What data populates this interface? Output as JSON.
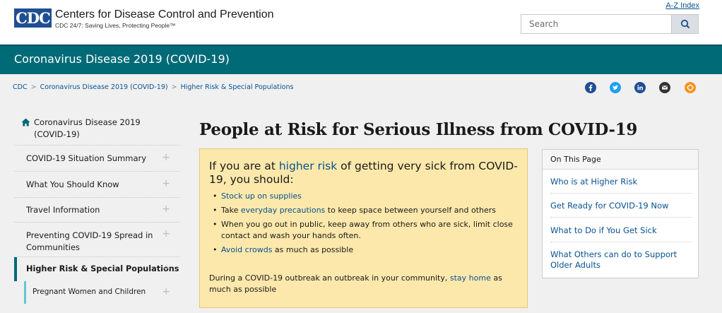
{
  "header": {
    "logo_text": "CDC",
    "org_name": "Centers for Disease Control and Prevention",
    "tagline": "CDC 24/7: Saving Lives, Protecting People™",
    "az_index": "A-Z Index",
    "search_placeholder": "Search",
    "search_icon": "magnifier-icon"
  },
  "banner": {
    "title": "Coronavirus Disease 2019 (COVID-19)"
  },
  "breadcrumb": {
    "items": [
      "CDC",
      "Coronavirus Disease 2019 (COVID-19)",
      "Higher Risk & Special Populations"
    ],
    "separator": ">"
  },
  "social": {
    "icons": [
      "facebook-icon",
      "twitter-icon",
      "linkedin-icon",
      "email-icon",
      "syndicate-icon"
    ],
    "colors": {
      "facebook": "#1f4e93",
      "twitter": "#1da1f2",
      "linkedin": "#1f4e93",
      "email": "#333333",
      "syndicate": "#f7941d"
    }
  },
  "nav": {
    "home_label": "Coronavirus Disease 2019 (COVID-19)",
    "items": [
      {
        "label": "COVID-19 Situation Summary",
        "toggle": "+"
      },
      {
        "label": "What You Should Know",
        "toggle": "+"
      },
      {
        "label": "Travel Information",
        "toggle": "+"
      },
      {
        "label": "Preventing COVID-19 Spread in Communities",
        "toggle": "+"
      },
      {
        "label": "Higher Risk & Special Populations",
        "toggle": "—"
      },
      {
        "label": "Pregnant Women and Children",
        "toggle": "+"
      }
    ]
  },
  "main": {
    "title": "People at Risk for Serious Illness from COVID-19",
    "callout": {
      "head_before": "If you are at ",
      "head_link": "higher risk",
      "head_after": " of getting very sick from COVID-19, you should:",
      "bullets": [
        {
          "link": "Stock up on supplies",
          "after": ""
        },
        {
          "before": "Take ",
          "link": "everyday precautions",
          "after": " to keep space between yourself and others"
        },
        {
          "text": "When you go out in public, keep away from others who are sick, limit close contact and wash your hands often."
        },
        {
          "link": "Avoid crowds",
          "after": " as much as possible"
        }
      ],
      "foot_before": "During a COVID-19 outbreak an outbreak in your community, ",
      "foot_link": "stay home",
      "foot_after": " as much as possible"
    }
  },
  "on_this_page": {
    "heading": "On This Page",
    "links": [
      "Who is at Higher Risk",
      "Get Ready for COVID-19 Now",
      "What to Do if You Get Sick",
      "What Others can do to Support Older Adults"
    ]
  },
  "colors": {
    "teal": "#006a77",
    "link": "#075290",
    "callout_bg": "#fce8ab",
    "cdc_blue": "#1f4e93"
  }
}
